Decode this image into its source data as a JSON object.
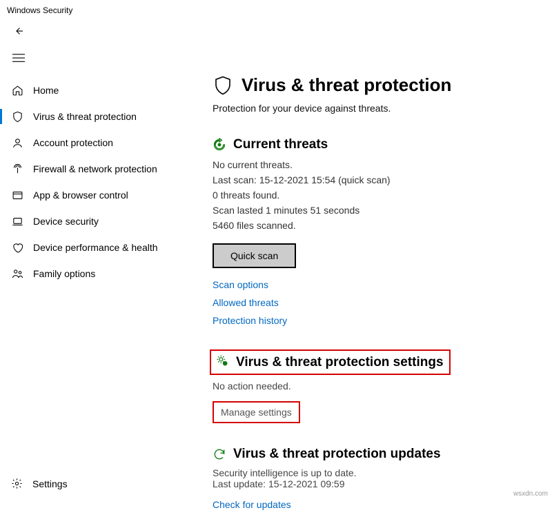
{
  "window_title": "Windows Security",
  "sidebar": {
    "items": [
      {
        "label": "Home"
      },
      {
        "label": "Virus & threat protection"
      },
      {
        "label": "Account protection"
      },
      {
        "label": "Firewall & network protection"
      },
      {
        "label": "App & browser control"
      },
      {
        "label": "Device security"
      },
      {
        "label": "Device performance & health"
      },
      {
        "label": "Family options"
      }
    ],
    "settings_label": "Settings"
  },
  "page": {
    "title": "Virus & threat protection",
    "subtitle": "Protection for your device against threats."
  },
  "threats": {
    "title": "Current threats",
    "line1": "No current threats.",
    "line2": "Last scan: 15-12-2021 15:54 (quick scan)",
    "line3": "0 threats found.",
    "line4": "Scan lasted 1 minutes 51 seconds",
    "line5": "5460 files scanned.",
    "quick_scan_label": "Quick scan",
    "link1": "Scan options",
    "link2": "Allowed threats",
    "link3": "Protection history"
  },
  "settings_section": {
    "title": "Virus & threat protection settings",
    "status": "No action needed.",
    "manage_label": "Manage settings"
  },
  "updates": {
    "title": "Virus & threat protection updates",
    "line1": "Security intelligence is up to date.",
    "line2": "Last update: 15-12-2021 09:59",
    "check_label": "Check for updates"
  },
  "watermark": "wsxdn.com"
}
